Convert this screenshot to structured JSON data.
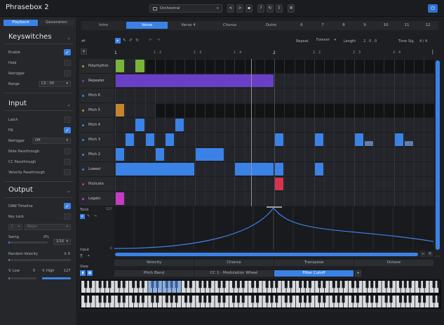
{
  "app": {
    "title": "Phrasebox 2",
    "preset": "Orchestral"
  },
  "titlebar": {
    "nav_prev": "<",
    "nav_next": ">",
    "help": "?",
    "settings_icon": "gear-icon"
  },
  "mode_tabs": [
    {
      "label": "Playback",
      "active": true
    },
    {
      "label": "Generation",
      "active": false
    }
  ],
  "keyswitches": {
    "title": "Keyswitches",
    "rows": [
      {
        "label": "Enable",
        "checked": true
      },
      {
        "label": "Hold",
        "checked": false
      },
      {
        "label": "Retrigger",
        "checked": false
      }
    ],
    "range_label": "Range",
    "range_value": "C0 : 00"
  },
  "input": {
    "title": "Input",
    "latch_label": "Latch",
    "fill_label": "Fill",
    "retrigger_label": "Retrigger",
    "retrigger_value": "Off",
    "note_passthrough": "Note Passthrough",
    "cc_passthrough": "CC Passthrough",
    "velocity_passthrough": "Velocity Passthrough"
  },
  "output": {
    "title": "Output",
    "daw_timeline": "DAW Timeline",
    "key_lock": "Key Lock",
    "key_value": "C",
    "scale_value": "Major",
    "swing_label": "Swing",
    "swing_value": "0%",
    "swing_division": "1/16",
    "random_velocity_label": "Random Velocity",
    "random_velocity_value": "± 0",
    "vlow_label": "V. Low",
    "vlow_value": "0",
    "vhigh_label": "V. High",
    "vhigh_value": "127"
  },
  "sections": [
    "Intro",
    "Verse",
    "Verse 4",
    "Chorus",
    "Outro",
    "6",
    "7",
    "8",
    "9",
    "10",
    "11",
    "12"
  ],
  "active_section": "Verse",
  "toolbar": {
    "repeat_label": "Repeat",
    "repeat_value": "Forever",
    "length_label": "Length",
    "length_value": "2 . 0 . 0",
    "time_sig_label": "Time Sig.",
    "time_sig_value": "4 / 4"
  },
  "ruler": [
    "1",
    "1 . 2",
    "1 . 3",
    "1 . 4",
    "2",
    "2 . 2",
    "2 . 3",
    "2 . 4"
  ],
  "lanes": [
    {
      "name": "Polyrhythm",
      "color": "#7bb33a"
    },
    {
      "name": "Repeater",
      "color": "#6a3fc8"
    },
    {
      "name": "Pitch 6",
      "color": "#3b82e6"
    },
    {
      "name": "Pitch 5",
      "color": "#c7822e"
    },
    {
      "name": "Pitch 4",
      "color": "#3b82e6"
    },
    {
      "name": "Pitch 3",
      "color": "#3b82e6"
    },
    {
      "name": "Pitch 2",
      "color": "#3b82e6"
    },
    {
      "name": "Lowest",
      "color": "#3b82e6"
    },
    {
      "name": "Pizzicato",
      "color": "#d6334f"
    },
    {
      "name": "Legato",
      "color": "#c43cc4"
    }
  ],
  "tools": {
    "label": "Tools",
    "max_value": "127",
    "min_value": "0"
  },
  "input_section": {
    "label": "Input"
  },
  "param_tabs": [
    "Velocity",
    "Chance",
    "Transpose",
    "Octave"
  ],
  "cc_tabs": [
    "Pitch Bend",
    "CC 1 - Modulation Wheel",
    "Filter Cutoff"
  ],
  "active_cc": "Filter Cutoff",
  "view": {
    "label": "View"
  },
  "colors": {
    "accent": "#3b82e6"
  }
}
